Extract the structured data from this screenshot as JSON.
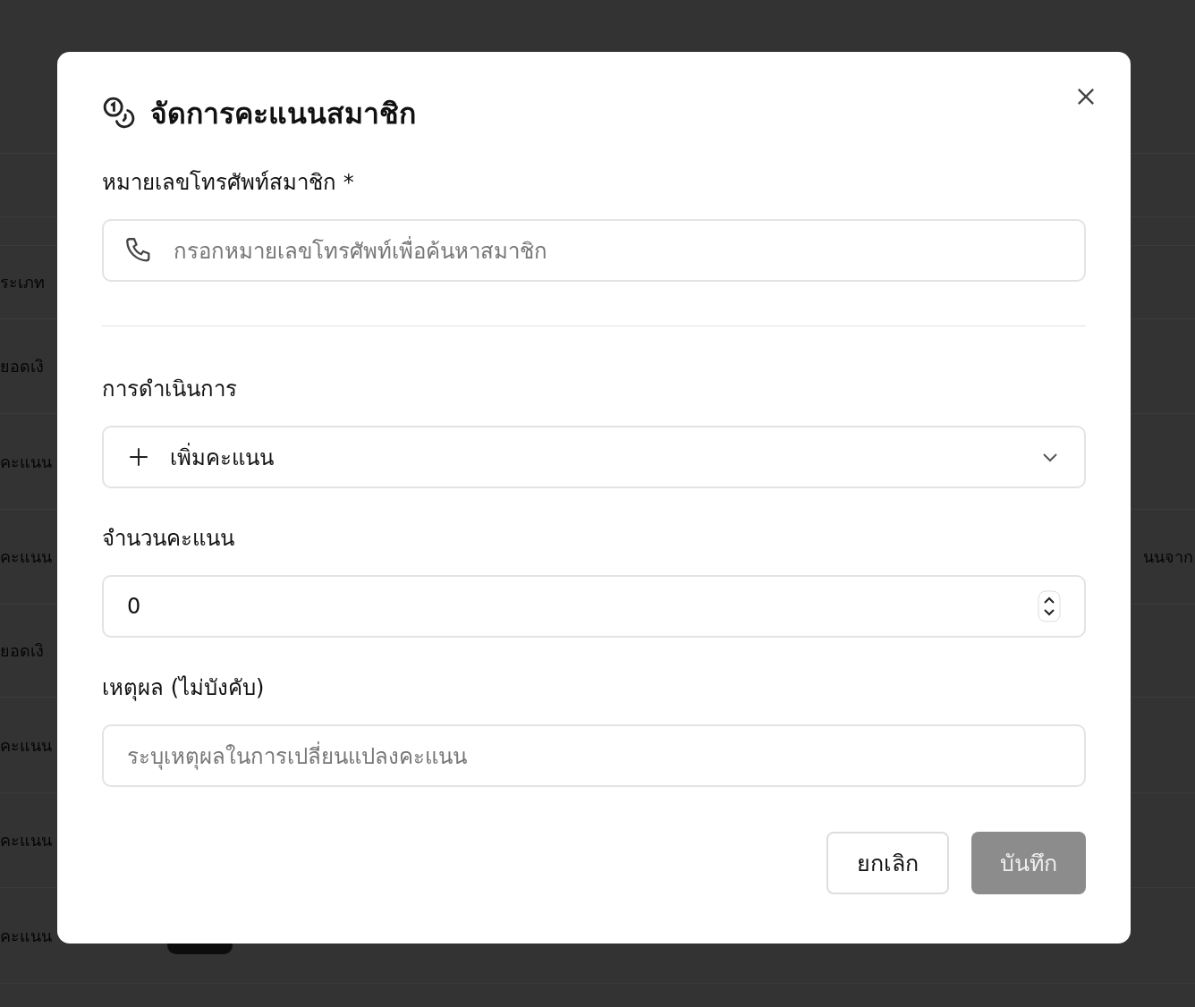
{
  "background": {
    "rows": [
      {
        "label": "ระเภท"
      },
      {
        "label": "ยอดเงิ"
      },
      {
        "label": "คะแนน"
      },
      {
        "label": "คะแนน",
        "trailing": "นนจาก"
      },
      {
        "label": "ยอดเงิ"
      },
      {
        "label": "คะแนน"
      },
      {
        "label": "คะแนน"
      },
      {
        "label": "คะแนน"
      }
    ]
  },
  "dialog": {
    "title": "จัดการคะแนนสมาชิก",
    "sections": [
      {
        "fields": [
          {
            "kind": "phone",
            "label": "หมายเลขโทรศัพท์สมาชิก *",
            "placeholder": "กรอกหมายเลขโทรศัพท์เพื่อค้นหาสมาชิก"
          }
        ]
      },
      {
        "fields": [
          {
            "kind": "select",
            "label": "การดำเนินการ",
            "value": "เพิ่มคะแนน"
          },
          {
            "kind": "number",
            "label": "จำนวนคะแนน",
            "value": "0"
          },
          {
            "kind": "text",
            "label": "เหตุผล (ไม่บังคับ)",
            "placeholder": "ระบุเหตุผลในการเปลี่ยนแปลงคะแนน"
          }
        ]
      }
    ],
    "buttons": [
      {
        "label": "ยกเลิก",
        "kind": "secondary",
        "disabled": false
      },
      {
        "label": "บันทึก",
        "kind": "primary",
        "disabled": true
      }
    ]
  }
}
